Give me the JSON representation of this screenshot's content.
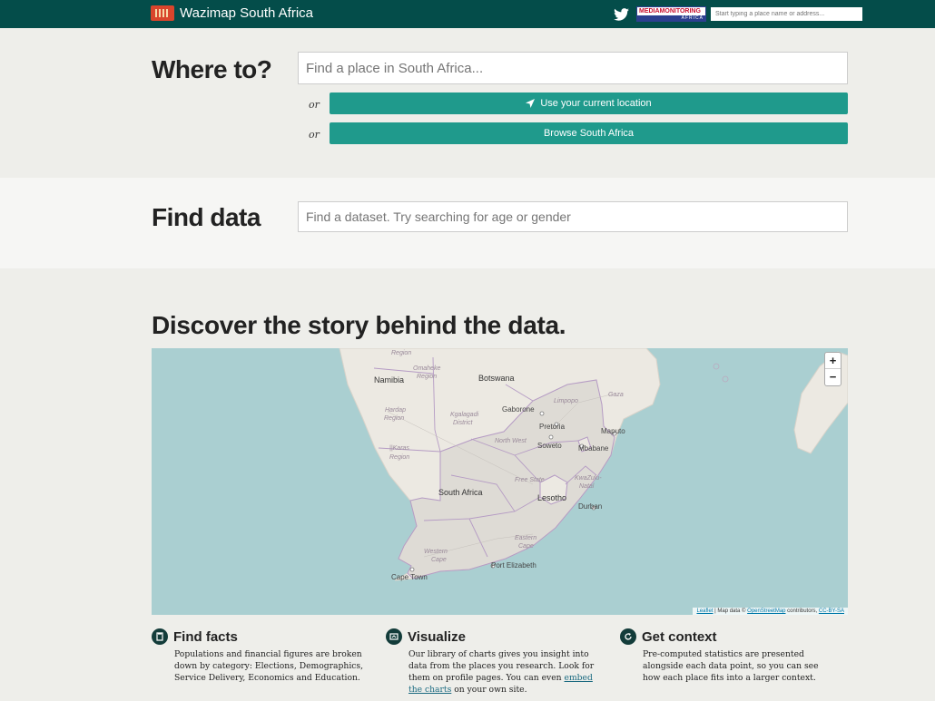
{
  "topbar": {
    "brand_title": "Wazimap South Africa",
    "partner_top": "MEDIAMONITORING",
    "partner_bottom": "AFRICA",
    "search_placeholder": "Start typing a place name or address..."
  },
  "where": {
    "heading": "Where to?",
    "input_placeholder": "Find a place in South Africa...",
    "or_label": "or",
    "location_button": "Use your current location",
    "browse_button": "Browse South Africa"
  },
  "find": {
    "heading": "Find data",
    "input_placeholder": "Find a dataset. Try searching for age or gender"
  },
  "discover": {
    "heading": "Discover the story behind the data.",
    "map": {
      "zoom_in": "+",
      "zoom_out": "−",
      "attribution_leaflet": "Leaflet",
      "attribution_text": " | Map data © ",
      "attribution_osm": "OpenStreetMap",
      "attribution_contrib": " contributors, ",
      "attribution_license": "CC-BY-SA",
      "labels": {
        "region_top": "Region",
        "omaheke": "Omaheke",
        "omaheke_region": "Region",
        "namibia": "Namibia",
        "botswana": "Botswana",
        "hardap": "Hardap",
        "hardap_region": "Region",
        "kgalagadi": "Kgalagadi",
        "district": "District",
        "gaborone": "Gaborone",
        "limpopo": "Limpopo",
        "gaza": "Gaza",
        "pretoria": "Pretoria",
        "maputo": "Maputo",
        "north_west": "North West",
        "soweto": "Soweto",
        "mbabane": "Mbabane",
        "karas": "||Karas",
        "karas_region": "Region",
        "free_state": "Free State",
        "kwazulu": "KwaZulu-",
        "natal": "Natal",
        "south_africa": "South Africa",
        "lesotho": "Lesotho",
        "durban": "Durban",
        "eastern": "Eastern",
        "cape_e": "Cape",
        "western": "Western",
        "cape_w": "Cape",
        "port_elizabeth": "Port Elizabeth",
        "cape_town": "Cape Town"
      }
    }
  },
  "features": [
    {
      "title": "Find facts",
      "icon": "book-icon",
      "body": "Populations and financial figures are broken down by category: Elections, Demographics, Service Delivery, Economics and Education."
    },
    {
      "title": "Visualize",
      "icon": "chart-icon",
      "body_pre": "Our library of charts gives you insight into data from the places you research. Look for them on profile pages. You can even ",
      "link": "embed the charts",
      "body_post": " on your own site."
    },
    {
      "title": "Get context",
      "icon": "refresh-icon",
      "body": "Pre-computed statistics are presented alongside each data point, so you can see how each place fits into a larger context."
    }
  ],
  "colors": {
    "topbar": "#044d4a",
    "button": "#1f9a8c",
    "ocean": "#aacfd1",
    "land": "#ece9e2"
  }
}
